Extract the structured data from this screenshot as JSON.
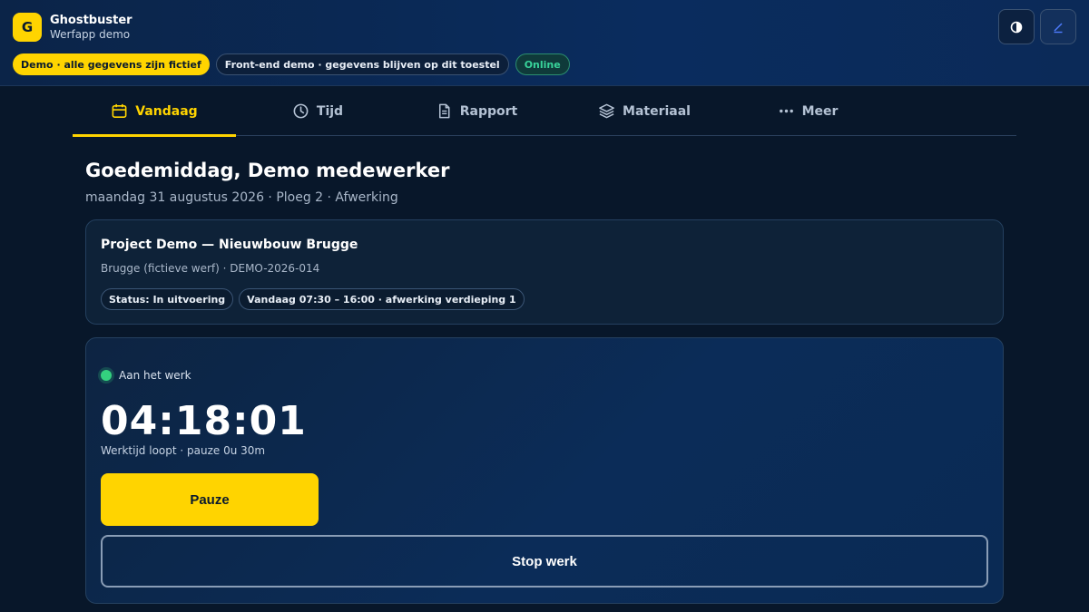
{
  "header": {
    "logo_letter": "G",
    "app_name": "Ghostbuster",
    "app_subtitle": "Werfapp demo",
    "pills": {
      "demo": "Demo · alle gegevens zijn fictief",
      "local": "Front-end demo · gegevens blijven op dit toestel",
      "online": "Online"
    },
    "icons": {
      "contrast": "contrast-icon",
      "edit": "edit-icon"
    }
  },
  "nav": {
    "tabs": [
      {
        "label": "Vandaag",
        "icon": "calendar-icon",
        "active": true
      },
      {
        "label": "Tijd",
        "icon": "clock-icon",
        "active": false
      },
      {
        "label": "Rapport",
        "icon": "document-icon",
        "active": false
      },
      {
        "label": "Materiaal",
        "icon": "layers-icon",
        "active": false
      },
      {
        "label": "Meer",
        "icon": "more-icon",
        "active": false
      }
    ]
  },
  "greeting": {
    "title": "Goedemiddag, Demo medewerker",
    "subtitle": "maandag 31 augustus 2026 · Ploeg 2 · Afwerking"
  },
  "project": {
    "title": "Project Demo — Nieuwbouw Brugge",
    "meta": "Brugge (fictieve werf) · DEMO-2026-014",
    "status_tag": "Status: In uitvoering",
    "schedule_tag": "Vandaag 07:30 – 16:00 · afwerking verdieping 1"
  },
  "timer": {
    "status": "Aan het werk",
    "elapsed": "04:18:01",
    "note": "Werktijd loopt · pauze 0u 30m",
    "pause_label": "Pauze",
    "stop_label": "Stop werk"
  },
  "colors": {
    "accent": "#ffd400",
    "online": "#38d39a",
    "status_active": "#34d17f",
    "background": "#08172a"
  }
}
